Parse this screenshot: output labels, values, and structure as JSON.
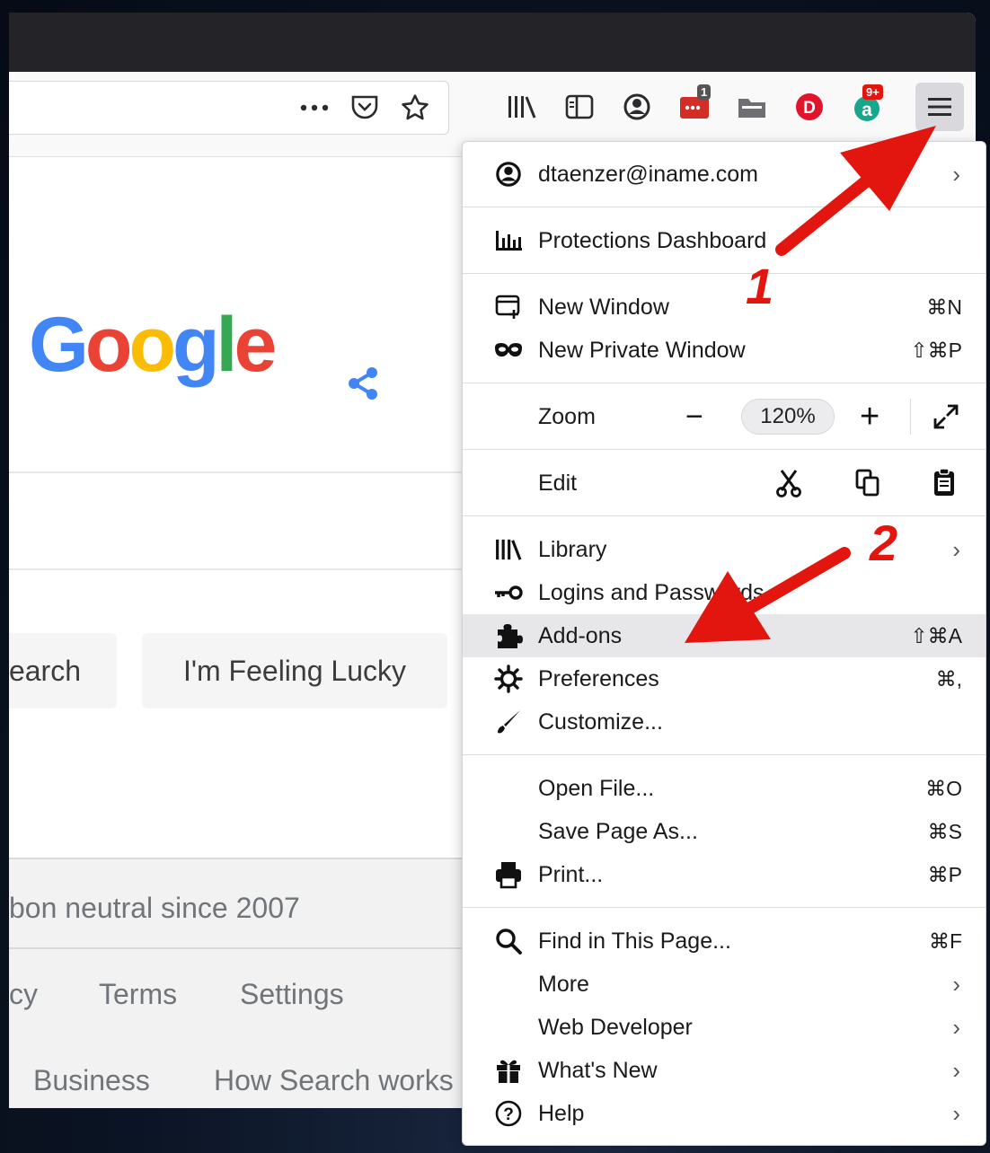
{
  "toolbar": {
    "more_icon": "ellipsis-icon",
    "badge_1": "1",
    "badge_2": "9+"
  },
  "page": {
    "search_button": "earch",
    "lucky_button": "I'm Feeling Lucky",
    "carbon_text": "bon neutral since 2007",
    "footer_links_1": [
      "cy",
      "Terms",
      "Settings"
    ],
    "footer_links_2": [
      "Business",
      "How Search works"
    ]
  },
  "menu": {
    "account": "dtaenzer@iname.com",
    "protections": "Protections Dashboard",
    "new_window": "New Window",
    "new_window_shortcut": "⌘N",
    "new_private_window": "New Private Window",
    "new_private_window_shortcut": "⇧⌘P",
    "zoom_label": "Zoom",
    "zoom_minus": "−",
    "zoom_value": "120%",
    "zoom_plus": "+",
    "edit_label": "Edit",
    "library": "Library",
    "logins": "Logins and Passwords",
    "addons": "Add-ons",
    "addons_shortcut": "⇧⌘A",
    "preferences": "Preferences",
    "preferences_shortcut": "⌘,",
    "customize": "Customize...",
    "open_file": "Open File...",
    "open_file_shortcut": "⌘O",
    "save_page": "Save Page As...",
    "save_page_shortcut": "⌘S",
    "print": "Print...",
    "print_shortcut": "⌘P",
    "find": "Find in This Page...",
    "find_shortcut": "⌘F",
    "more": "More",
    "web_developer": "Web Developer",
    "whats_new": "What's New",
    "help": "Help",
    "chevron": "›"
  },
  "annotations": {
    "label_1": "1",
    "label_2": "2",
    "arrow_color": "#e3160f"
  }
}
